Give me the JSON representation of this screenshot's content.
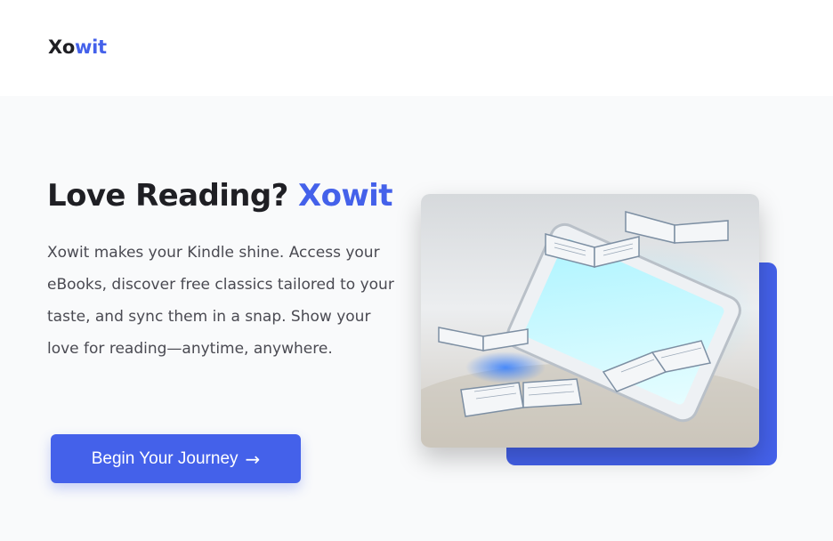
{
  "brand": {
    "name_part1": "Xo",
    "name_part2": "wit",
    "accent_color": "#4461ea"
  },
  "hero": {
    "headline_main": "Love Reading?",
    "headline_accent": "Xowit",
    "description": "Xowit makes your Kindle shine. Access your eBooks, discover free classics tailored to your taste, and sync them in a snap. Show your love for reading—anytime, anywhere.",
    "cta_label": "Begin Your Journey",
    "cta_icon": "arrow-right-icon",
    "image_subject": "e-reader-with-open-books-illustration"
  },
  "colors": {
    "primary": "#4461ea",
    "text_dark": "#1f1f24",
    "text_body": "#4a4a52",
    "hero_background": "#f9fafb"
  }
}
